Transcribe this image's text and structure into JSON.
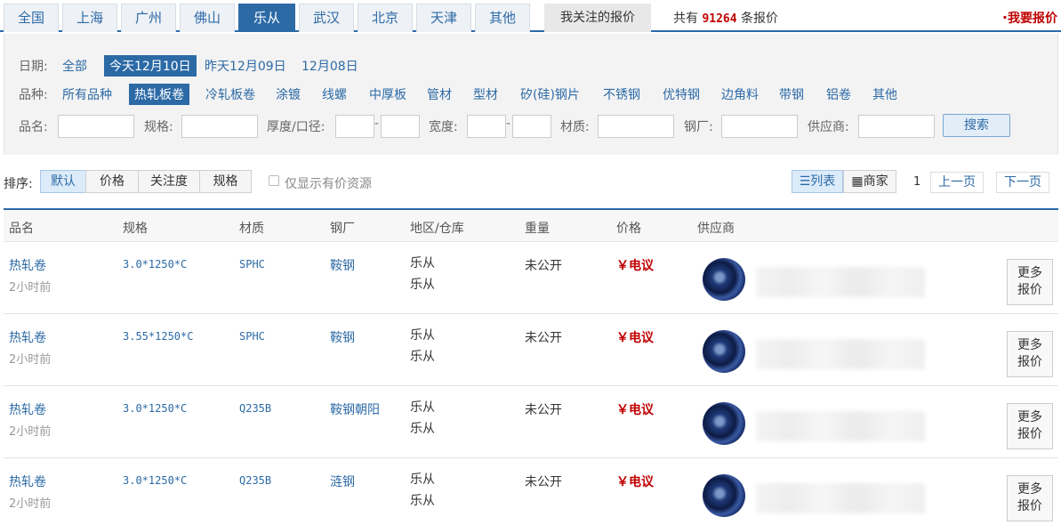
{
  "city_tabs": [
    "全国",
    "上海",
    "广州",
    "佛山",
    "乐从",
    "武汉",
    "北京",
    "天津",
    "其他"
  ],
  "active_city": "乐从",
  "follow_tab": "我关注的报价",
  "total": {
    "prefix": "共有",
    "count": "91264",
    "suffix": "条报价"
  },
  "my_quote": "我要报价",
  "filters": {
    "date_label": "日期:",
    "dates": [
      "全部",
      "今天12月10日",
      "昨天12月09日",
      "12月08日"
    ],
    "date_selected": "今天12月10日",
    "category_label": "品种:",
    "categories": [
      "所有品种",
      "热轧板卷",
      "冷轧板卷",
      "涂镀",
      "线螺",
      "中厚板",
      "管材",
      "型材",
      "矽(硅)钢片",
      "不锈钢",
      "优特钢",
      "边角料",
      "带钢",
      "铝卷",
      "其他"
    ],
    "category_selected": "热轧板卷",
    "fields": {
      "name": "品名:",
      "spec": "规格:",
      "thickness": "厚度/口径:",
      "width": "宽度:",
      "material": "材质:",
      "mill": "钢厂:",
      "supplier": "供应商:"
    },
    "range_sep": "-",
    "search_button": "搜索"
  },
  "sort": {
    "label": "排序:",
    "options": [
      "默认",
      "价格",
      "关注度",
      "规格"
    ],
    "selected": "默认",
    "checkbox_label": "仅显示有价资源"
  },
  "view": {
    "list": "列表",
    "merchant": "商家"
  },
  "pagination": {
    "page": "1",
    "prev": "上一页",
    "next": "下一页"
  },
  "table": {
    "headers": [
      "品名",
      "规格",
      "材质",
      "钢厂",
      "地区/仓库",
      "重量",
      "价格",
      "供应商"
    ],
    "rows": [
      {
        "name": "热轧卷",
        "time": "2小时前",
        "spec": "3.0*1250*C",
        "material": "SPHC",
        "mill": "鞍钢",
        "region": "乐从",
        "warehouse": "乐从",
        "weight": "未公开",
        "price": "￥电议",
        "more": "更多报价"
      },
      {
        "name": "热轧卷",
        "time": "2小时前",
        "spec": "3.55*1250*C",
        "material": "SPHC",
        "mill": "鞍钢",
        "region": "乐从",
        "warehouse": "乐从",
        "weight": "未公开",
        "price": "￥电议",
        "more": "更多报价"
      },
      {
        "name": "热轧卷",
        "time": "2小时前",
        "spec": "3.0*1250*C",
        "material": "Q235B",
        "mill": "鞍钢朝阳",
        "region": "乐从",
        "warehouse": "乐从",
        "weight": "未公开",
        "price": "￥电议",
        "more": "更多报价"
      },
      {
        "name": "热轧卷",
        "time": "2小时前",
        "spec": "3.0*1250*C",
        "material": "Q235B",
        "mill": "涟钢",
        "region": "乐从",
        "warehouse": "乐从",
        "weight": "未公开",
        "price": "￥电议",
        "more": "更多报价"
      }
    ]
  },
  "colors": {
    "accent": "#2c6aa6",
    "price": "#c00000",
    "total": "#c00000"
  }
}
